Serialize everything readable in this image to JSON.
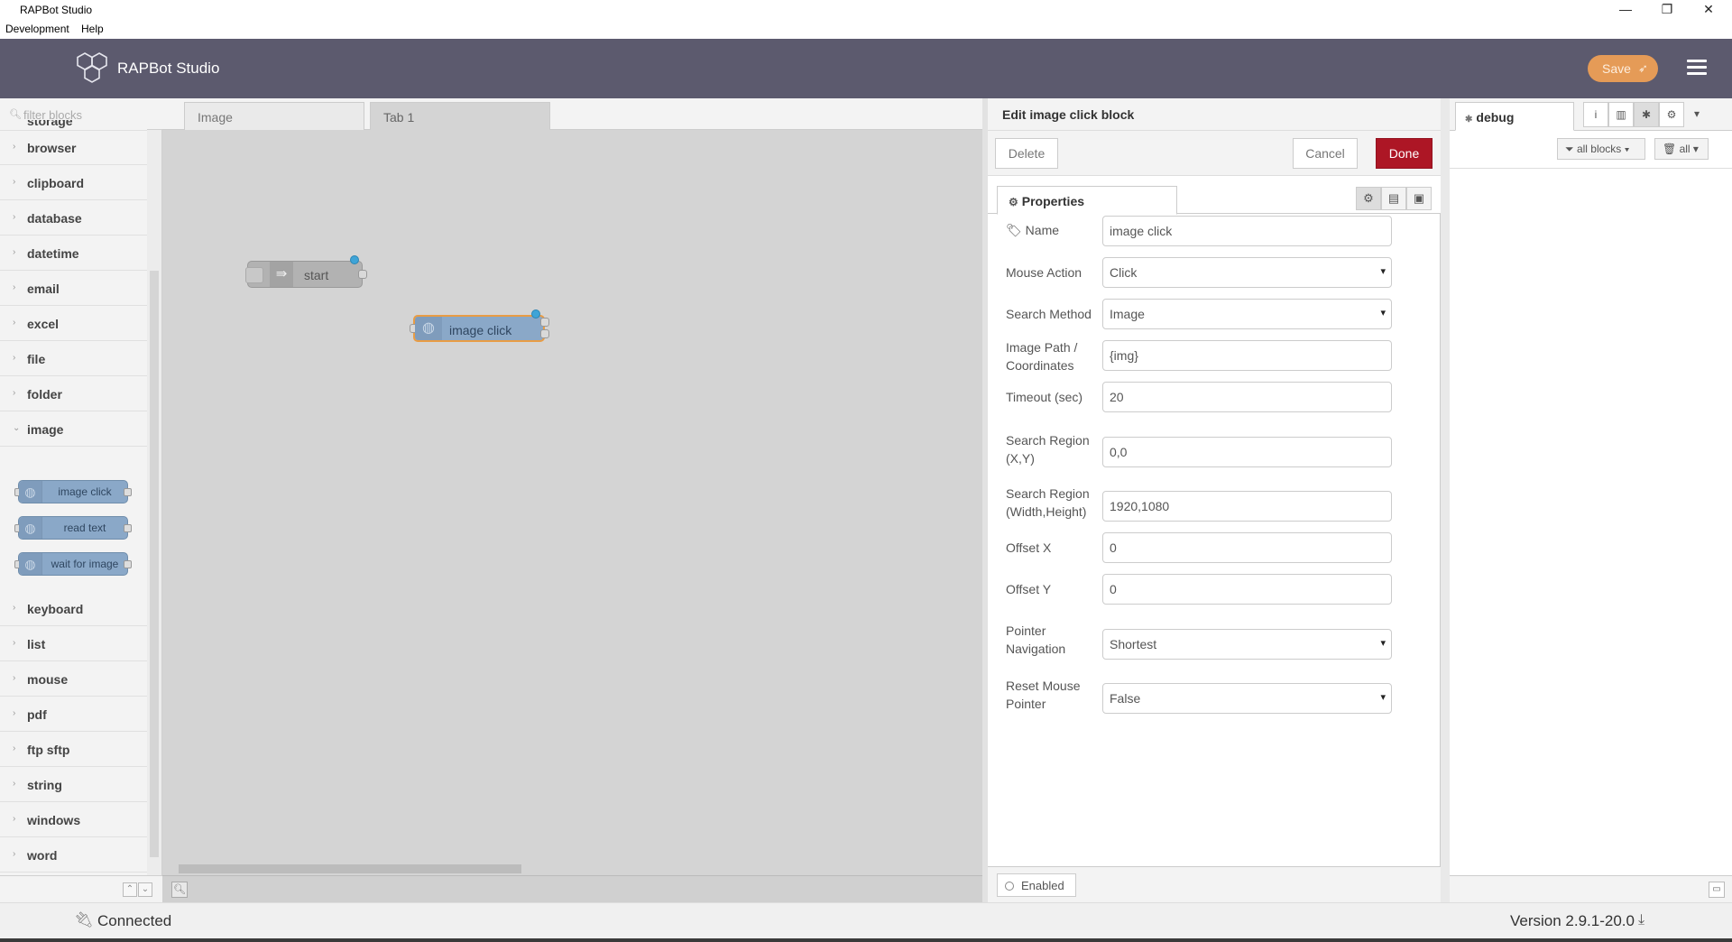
{
  "window": {
    "title": "RAPBot Studio",
    "minimize_glyph": "—",
    "restore_glyph": "❐",
    "close_glyph": "✕"
  },
  "menubar": {
    "items": [
      "Development",
      "Help"
    ]
  },
  "header": {
    "brand": "RAPBot Studio",
    "save_label": "Save",
    "accent_color": "#e59b57",
    "header_color": "#5c5a6e"
  },
  "palette": {
    "filter_placeholder": "filter blocks",
    "categories_top": [
      "storage",
      "browser",
      "clipboard",
      "database",
      "datetime",
      "email",
      "excel",
      "file",
      "folder"
    ],
    "expanded_category": "image",
    "image_blocks": [
      "image click",
      "read text",
      "wait for image"
    ],
    "categories_bottom": [
      "keyboard",
      "list",
      "mouse",
      "pdf",
      "ftp sftp",
      "string",
      "windows",
      "word"
    ]
  },
  "workspace": {
    "tabs": [
      "Image",
      "Tab 1"
    ],
    "active_tab": "Tab 1",
    "nodes": {
      "start": "start",
      "image_click": "image click"
    }
  },
  "tray": {
    "title": "Edit image click block",
    "delete_label": "Delete",
    "cancel_label": "Cancel",
    "done_label": "Done",
    "properties_tab": "Properties",
    "fields": {
      "name": {
        "label": "Name",
        "value": "image click"
      },
      "mouse_action": {
        "label": "Mouse Action",
        "value": "Click"
      },
      "search_method": {
        "label": "Search Method",
        "value": "Image"
      },
      "image_path": {
        "label_line1": "Image Path /",
        "label_line2": "Coordinates",
        "value": "{img}"
      },
      "timeout": {
        "label": "Timeout (sec)",
        "value": "20"
      },
      "search_region_xy": {
        "label_line1": "Search Region",
        "label_line2": "(X,Y)",
        "value": "0,0"
      },
      "search_region_wh": {
        "label_line1": "Search Region",
        "label_line2": "(Width,Height)",
        "value": "1920,1080"
      },
      "offset_x": {
        "label": "Offset X",
        "value": "0"
      },
      "offset_y": {
        "label": "Offset Y",
        "value": "0"
      },
      "pointer_navigation": {
        "label_line1": "Pointer",
        "label_line2": "Navigation",
        "value": "Shortest"
      },
      "reset_mouse": {
        "label_line1": "Reset Mouse",
        "label_line2": "Pointer",
        "value": "False"
      }
    },
    "enabled_label": "Enabled"
  },
  "sidebar": {
    "tab_label": "debug",
    "filter_label": "all blocks",
    "clear_label": "all"
  },
  "status": {
    "connection": "Connected",
    "version": "Version 2.9.1-20.0"
  }
}
